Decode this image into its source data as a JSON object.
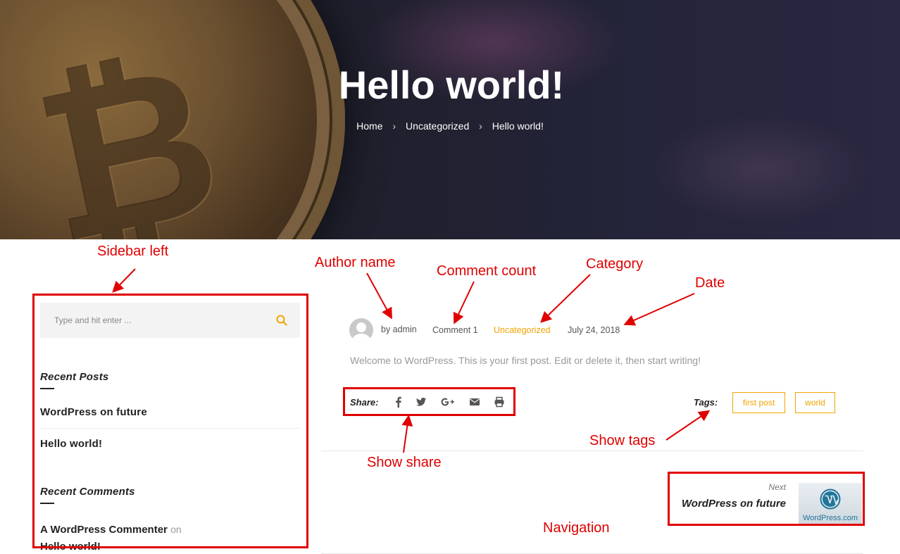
{
  "hero": {
    "title": "Hello world!",
    "breadcrumb": [
      "Home",
      "Uncategorized",
      "Hello world!"
    ],
    "breadcrumb_separator": "›"
  },
  "sidebar": {
    "search_placeholder": "Type and hit enter ...",
    "recent_posts_title": "Recent Posts",
    "recent_posts": [
      "WordPress on future",
      "Hello world!"
    ],
    "recent_comments_title": "Recent Comments",
    "recent_comment": {
      "author": "A WordPress Commenter",
      "on": "on",
      "post": "Hello world!"
    }
  },
  "post": {
    "author": "by admin",
    "comments": "Comment 1",
    "category": "Uncategorized",
    "date": "July 24, 2018",
    "excerpt": "Welcome to WordPress. This is your first post. Edit or delete it, then start writing!",
    "share_label": "Share:",
    "share_icons": [
      "facebook-icon",
      "twitter-icon",
      "google-plus-icon",
      "email-icon",
      "print-icon"
    ],
    "tags_label": "Tags:",
    "tags": [
      "first post",
      "world"
    ]
  },
  "navigation": {
    "next_label": "Next",
    "next_title": "WordPress on future",
    "thumb_text": "WordPress.com"
  },
  "annotations": {
    "sidebar_left": "Sidebar left",
    "author_name": "Author name",
    "comment_count": "Comment count",
    "category": "Category",
    "date": "Date",
    "show_share": "Show share",
    "show_tags": "Show tags",
    "navigation": "Navigation"
  },
  "colors": {
    "accent": "#f0a500",
    "annotation": "#e00000",
    "hero_bg": "#1f1f2d"
  }
}
